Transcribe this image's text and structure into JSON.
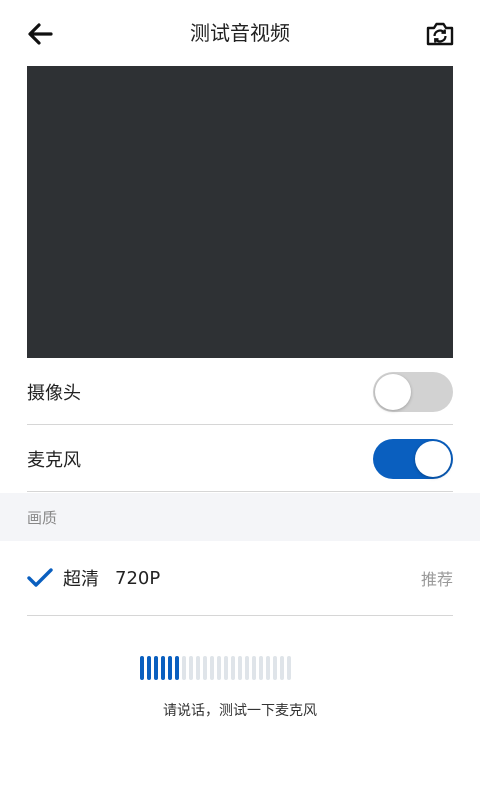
{
  "header": {
    "title": "测试音视频",
    "back_icon": "arrow-left-icon",
    "switch_camera_icon": "camera-switch-icon"
  },
  "controls": {
    "camera": {
      "label": "摄像头",
      "enabled": false
    },
    "microphone": {
      "label": "麦克风",
      "enabled": true
    }
  },
  "quality": {
    "section_title": "画质",
    "selected": {
      "name": "超清",
      "resolution": "720P",
      "tag": "推荐",
      "checked": true
    }
  },
  "mic_test": {
    "level_active_bars": 6,
    "total_bars": 22,
    "hint": "请说话，测试一下麦克风"
  },
  "colors": {
    "accent": "#0a5fbf",
    "preview_bg": "#2e3134",
    "section_bg": "#f4f5f8"
  }
}
